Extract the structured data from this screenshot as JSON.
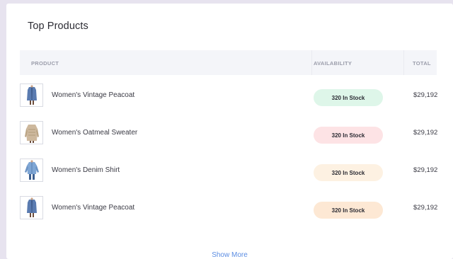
{
  "card": {
    "title": "Top Products",
    "columns": {
      "product": "PRODUCT",
      "availability": "AVAILABILITY",
      "total": "TOTAL"
    },
    "rows": [
      {
        "name": "Women's Vintage Peacoat",
        "availability": "320 In Stock",
        "total": "$29,192",
        "badge_color": "#def6e9",
        "thumb": "jacket-photo"
      },
      {
        "name": "Women's Oatmeal Sweater",
        "availability": "320 In Stock",
        "total": "$29,192",
        "badge_color": "#fde3e5",
        "thumb": "sweater-photo"
      },
      {
        "name": "Women's Denim Shirt",
        "availability": "320 In Stock",
        "total": "$29,192",
        "badge_color": "#fdf1e2",
        "thumb": "denim-shirt-photo"
      },
      {
        "name": "Women's Vintage Peacoat",
        "availability": "320 In Stock",
        "total": "$29,192",
        "badge_color": "#fde8d4",
        "thumb": "jacket-photo"
      }
    ],
    "show_more": "Show More"
  },
  "colors": {
    "background": "#e7e3ef",
    "link": "#5b8de3",
    "header_bg": "#f4f5f9"
  }
}
